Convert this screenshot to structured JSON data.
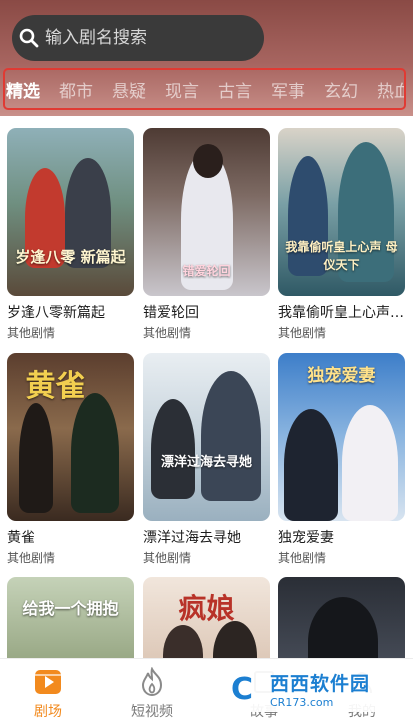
{
  "search": {
    "placeholder": "输入剧名搜索",
    "icon": "search-icon"
  },
  "tabs": [
    {
      "label": "精选",
      "active": true
    },
    {
      "label": "都市"
    },
    {
      "label": "悬疑"
    },
    {
      "label": "现言"
    },
    {
      "label": "古言"
    },
    {
      "label": "军事"
    },
    {
      "label": "玄幻"
    },
    {
      "label": "热血"
    }
  ],
  "dramas": [
    {
      "title": "岁逢八零新篇起",
      "category": "其他剧情",
      "poster_text": "岁逢八零 新篇起"
    },
    {
      "title": "错爱轮回",
      "category": "其他剧情",
      "poster_text": "错爱轮回"
    },
    {
      "title": "我靠偷听皇上心声…",
      "category": "其他剧情",
      "poster_text": "我靠偷听皇上心声 母仪天下"
    },
    {
      "title": "黄雀",
      "category": "其他剧情",
      "poster_text": "黄雀"
    },
    {
      "title": "漂洋过海去寻她",
      "category": "其他剧情",
      "poster_text": "漂洋过海去寻她"
    },
    {
      "title": "独宠爱妻",
      "category": "其他剧情",
      "poster_text": "独宠爱妻"
    },
    {
      "title": "",
      "category": "",
      "poster_text": "给我一个拥抱"
    },
    {
      "title": "",
      "category": "",
      "poster_text": "疯娘"
    },
    {
      "title": "",
      "category": "",
      "poster_text": ""
    }
  ],
  "nav": {
    "items": [
      {
        "label": "剧场",
        "icon": "theater-icon",
        "active": true
      },
      {
        "label": "短视频",
        "icon": "flame-icon"
      },
      {
        "label": "故事",
        "icon": "book-icon"
      },
      {
        "label": "我的",
        "icon": "user-icon"
      }
    ]
  },
  "watermark": {
    "logo": "C",
    "name": "西西软件园",
    "url": "CR173.com"
  },
  "colors": {
    "accent": "#f28a1e",
    "tab_outline": "#e03a33",
    "header": "#a76560"
  }
}
